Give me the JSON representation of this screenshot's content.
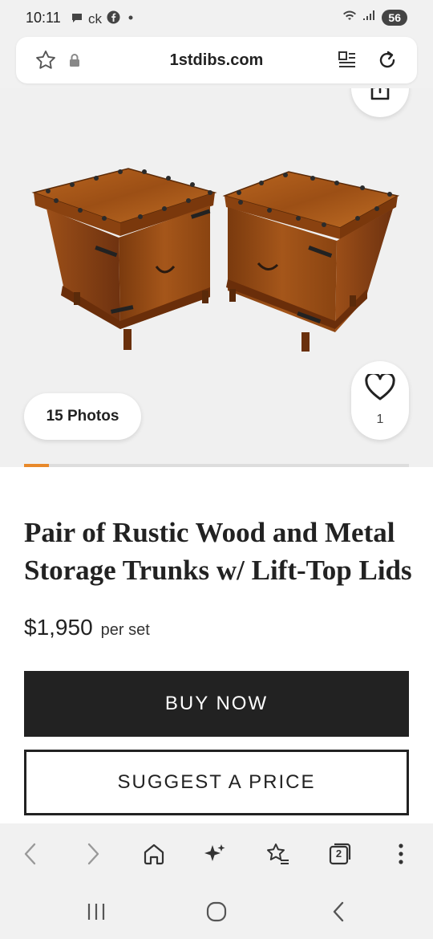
{
  "status_bar": {
    "time": "10:11",
    "carrier_text": "ck",
    "battery": "56"
  },
  "browser": {
    "url": "1stdibs.com"
  },
  "gallery": {
    "photos_button": "15 Photos",
    "favorites_count": "1",
    "progress_fraction": 0.065,
    "accent_color": "#e8892b"
  },
  "product": {
    "title": "Pair of Rustic Wood and Metal Storage Trunks w/ Lift-Top Lids",
    "price": "$1,950",
    "price_unit": "per set",
    "buy_now": "BUY NOW",
    "suggest_price": "SUGGEST A PRICE"
  },
  "toolbar": {
    "tab_count": "2",
    "icons": [
      "back-icon",
      "forward-icon",
      "home-icon",
      "sparkle-icon",
      "bookmarks-icon",
      "tabs-icon",
      "more-icon"
    ]
  },
  "system_nav": {
    "icons": [
      "recents-icon",
      "home-circle-icon",
      "system-back-icon"
    ]
  }
}
